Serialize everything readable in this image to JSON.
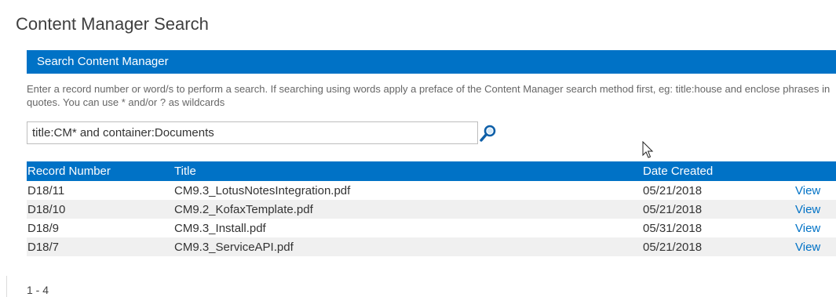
{
  "page": {
    "title": "Content Manager Search"
  },
  "panel": {
    "header": "Search Content Manager",
    "instructions": "Enter a record number or word/s to perform a search. If searching using words apply a preface of the Content Manager search method first, eg: title:house and enclose phrases in quotes. You can use * and/or ? as wildcards"
  },
  "search": {
    "value": "title:CM* and container:Documents",
    "icon": "search-icon"
  },
  "colors": {
    "accent": "#0072c6",
    "row_alt": "#f0f0f0",
    "title_text": "#3f3f3f"
  },
  "table": {
    "headers": {
      "record_number": "Record Number",
      "title": "Title",
      "date_created": "Date Created"
    },
    "rows": [
      {
        "record_number": "D18/11",
        "title": "CM9.3_LotusNotesIntegration.pdf",
        "date_created": "05/21/2018",
        "action": "View"
      },
      {
        "record_number": "D18/10",
        "title": "CM9.2_KofaxTemplate.pdf",
        "date_created": "05/21/2018",
        "action": "View"
      },
      {
        "record_number": "D18/9",
        "title": "CM9.3_Install.pdf",
        "date_created": "05/31/2018",
        "action": "View"
      },
      {
        "record_number": "D18/7",
        "title": "CM9.3_ServiceAPI.pdf",
        "date_created": "05/21/2018",
        "action": "View"
      }
    ]
  },
  "pager": {
    "range": "1 - 4"
  }
}
